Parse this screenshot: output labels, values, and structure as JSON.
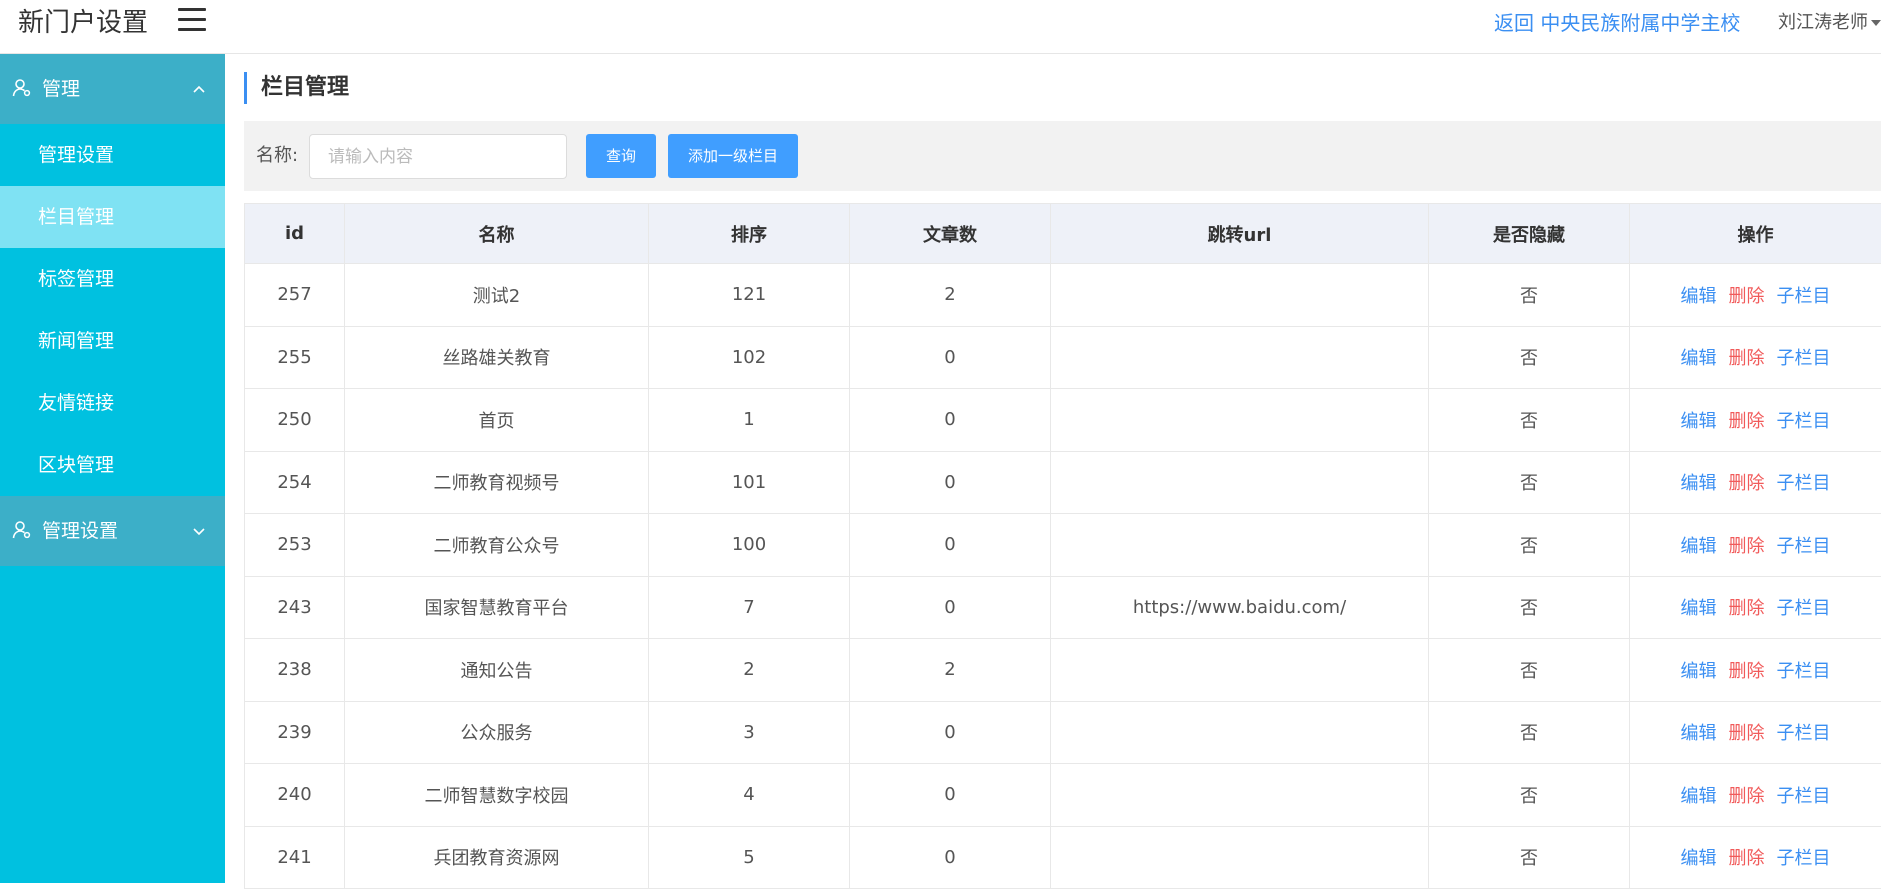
{
  "header": {
    "app_title": "新门户设置",
    "return_link": "返回 中央民族附属中学主校",
    "user_name": "刘江涛老师"
  },
  "sidebar": {
    "groups": [
      {
        "label": "管理",
        "expanded": true,
        "items": [
          {
            "label": "管理设置"
          },
          {
            "label": "栏目管理",
            "active": true
          },
          {
            "label": "标签管理"
          },
          {
            "label": "新闻管理"
          },
          {
            "label": "友情链接"
          },
          {
            "label": "区块管理"
          }
        ]
      },
      {
        "label": "管理设置",
        "expanded": false,
        "items": []
      }
    ]
  },
  "main": {
    "page_title": "栏目管理",
    "search": {
      "label": "名称:",
      "placeholder": "请输入内容",
      "value": ""
    },
    "buttons": {
      "query": "查询",
      "add": "添加一级栏目"
    },
    "table": {
      "columns": [
        "id",
        "名称",
        "排序",
        "文章数",
        "跳转url",
        "是否隐藏",
        "操作"
      ],
      "actions": {
        "edit": "编辑",
        "delete": "删除",
        "sub": "子栏目"
      },
      "rows": [
        {
          "id": "257",
          "name": "测试2",
          "sort": "121",
          "articles": "2",
          "url": "",
          "hidden": "否"
        },
        {
          "id": "255",
          "name": "丝路雄关教育",
          "sort": "102",
          "articles": "0",
          "url": "",
          "hidden": "否"
        },
        {
          "id": "250",
          "name": "首页",
          "sort": "1",
          "articles": "0",
          "url": "",
          "hidden": "否"
        },
        {
          "id": "254",
          "name": "二师教育视频号",
          "sort": "101",
          "articles": "0",
          "url": "",
          "hidden": "否"
        },
        {
          "id": "253",
          "name": "二师教育公众号",
          "sort": "100",
          "articles": "0",
          "url": "",
          "hidden": "否"
        },
        {
          "id": "243",
          "name": "国家智慧教育平台",
          "sort": "7",
          "articles": "0",
          "url": "https://www.baidu.com/",
          "hidden": "否"
        },
        {
          "id": "238",
          "name": "通知公告",
          "sort": "2",
          "articles": "2",
          "url": "",
          "hidden": "否"
        },
        {
          "id": "239",
          "name": "公众服务",
          "sort": "3",
          "articles": "0",
          "url": "",
          "hidden": "否"
        },
        {
          "id": "240",
          "name": "二师智慧数字校园",
          "sort": "4",
          "articles": "0",
          "url": "",
          "hidden": "否"
        },
        {
          "id": "241",
          "name": "兵团教育资源网",
          "sort": "5",
          "articles": "0",
          "url": "",
          "hidden": "否"
        }
      ]
    }
  },
  "colors": {
    "sidebar_bg": "#00c1e0",
    "sidebar_group_bg": "#3cafc8",
    "sidebar_active_bg": "#7fe2f3",
    "primary": "#409eff",
    "link": "#3b8ff2",
    "danger": "#f15a5a"
  }
}
